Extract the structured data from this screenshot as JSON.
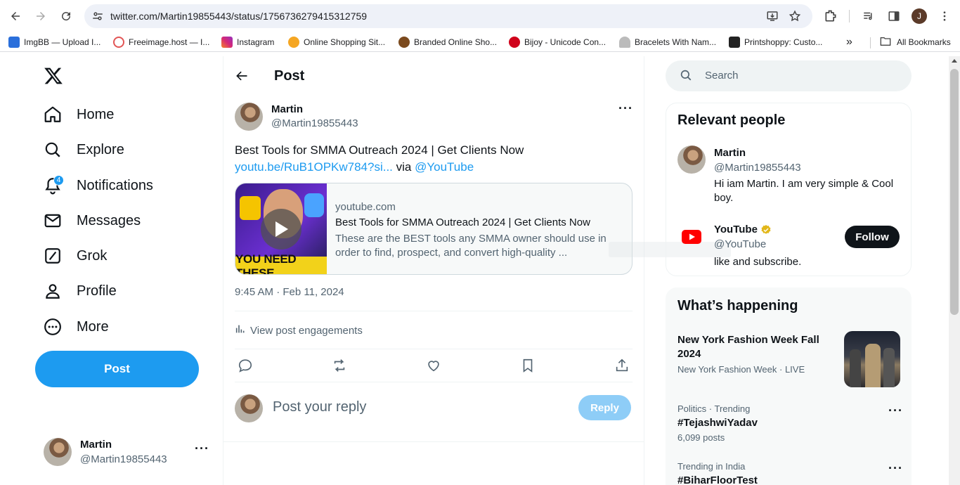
{
  "browser": {
    "url": "twitter.com/Martin19855443/status/1756736279415312759",
    "avatar_letter": "J",
    "bookmarks": [
      {
        "label": "ImgBB — Upload I...",
        "color": "#2a6fdb"
      },
      {
        "label": "Freeimage.host — I...",
        "color": "#e25555"
      },
      {
        "label": "Instagram",
        "color": "#d62976"
      },
      {
        "label": "Online Shopping Sit...",
        "color": "#f5a623"
      },
      {
        "label": "Branded Online Sho...",
        "color": "#7b4a1e"
      },
      {
        "label": "Bijoy - Unicode Con...",
        "color": "#d0021b"
      },
      {
        "label": "Bracelets With Nam...",
        "color": "#888888"
      },
      {
        "label": "Printshoppy: Custo...",
        "color": "#222222"
      }
    ],
    "all_bookmarks": "All Bookmarks"
  },
  "nav": {
    "items": [
      {
        "label": "Home",
        "icon": "home-icon"
      },
      {
        "label": "Explore",
        "icon": "search-icon"
      },
      {
        "label": "Notifications",
        "icon": "bell-icon",
        "badge": "4"
      },
      {
        "label": "Messages",
        "icon": "mail-icon"
      },
      {
        "label": "Grok",
        "icon": "grok-icon"
      },
      {
        "label": "Profile",
        "icon": "profile-icon"
      },
      {
        "label": "More",
        "icon": "more-circle-icon"
      }
    ],
    "post_label": "Post",
    "account": {
      "name": "Martin",
      "handle": "@Martin19855443"
    }
  },
  "tweet": {
    "header_title": "Post",
    "author_name": "Martin",
    "author_handle": "@Martin19855443",
    "text": "Best Tools for SMMA Outreach 2024  | Get Clients Now",
    "link_text": "youtu.be/RuB1OPKw784?si...",
    "via_text": " via ",
    "mention": "@YouTube",
    "card": {
      "domain": "youtube.com",
      "title": "Best Tools for SMMA Outreach 2024 | Get Clients Now",
      "description": "These are the BEST tools any SMMA owner should use in order to find, prospect, and convert high-quality ...",
      "thumb_caption": "YOU NEED THESE"
    },
    "timestamp": "9:45 AM · Feb 11, 2024",
    "engagements_label": "View post engagements",
    "reply_placeholder": "Post your reply",
    "reply_button": "Reply"
  },
  "sidebar": {
    "search_placeholder": "Search",
    "relevant_title": "Relevant people",
    "people": [
      {
        "name": "Martin",
        "handle": "@Martin19855443",
        "bio": "Hi iam Martin. I am very simple & Cool boy."
      },
      {
        "name": "YouTube",
        "handle": "@YouTube",
        "bio": "like and subscribe.",
        "follow": "Follow"
      }
    ],
    "happening_title": "What’s happening",
    "trends": [
      {
        "topic": "New York Fashion Week Fall 2024",
        "meta": "New York Fashion Week · LIVE"
      },
      {
        "meta": "Politics · Trending",
        "topic": "#TejashwiYadav",
        "count": "6,099 posts"
      },
      {
        "meta": "Trending in India",
        "topic": "#BiharFloorTest"
      }
    ]
  }
}
